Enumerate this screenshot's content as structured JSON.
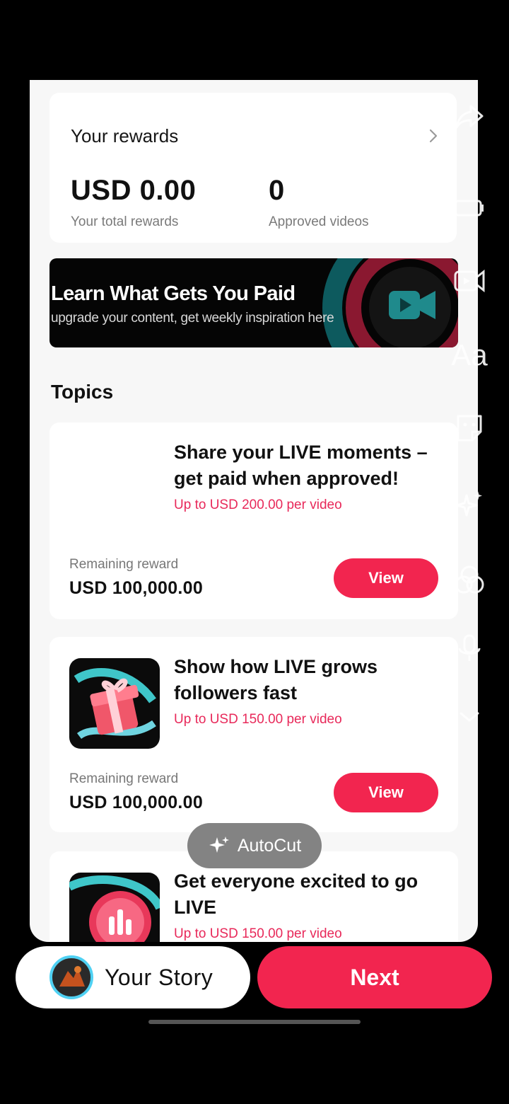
{
  "rewards": {
    "title": "Your rewards",
    "total_amount": "USD 0.00",
    "total_label": "Your total rewards",
    "approved_count": "0",
    "approved_label": "Approved videos"
  },
  "banner": {
    "title": "Learn What Gets You Paid",
    "subtitle": "upgrade your content, get weekly inspiration here"
  },
  "topics": {
    "heading": "Topics",
    "items": [
      {
        "title": "Share your LIVE moments – get paid when approved!",
        "reward": "Up to USD 200.00 per video",
        "remaining_label": "Remaining reward",
        "remaining_amount": "USD 100,000.00",
        "button": "View"
      },
      {
        "title": "Show how LIVE grows followers fast",
        "reward": "Up to USD 150.00 per video",
        "remaining_label": "Remaining reward",
        "remaining_amount": "USD 100,000.00",
        "button": "View"
      },
      {
        "title": "Get everyone excited to go LIVE",
        "reward": "Up to USD 150.00 per video"
      }
    ]
  },
  "autocut": {
    "label": "AutoCut",
    "icon": "sparkle-icon"
  },
  "tools": [
    "share-arrow-icon",
    "battery-icon",
    "video-icon",
    "text-icon",
    "sticker-icon",
    "effects-icon",
    "filters-icon",
    "mic-icon",
    "chevron-down-icon"
  ],
  "tool_text": "Aa",
  "bottom": {
    "story_label": "Your Story",
    "next_label": "Next"
  },
  "colors": {
    "accent": "#f2254f",
    "reward_text": "#e8295a",
    "background": "#000000"
  }
}
